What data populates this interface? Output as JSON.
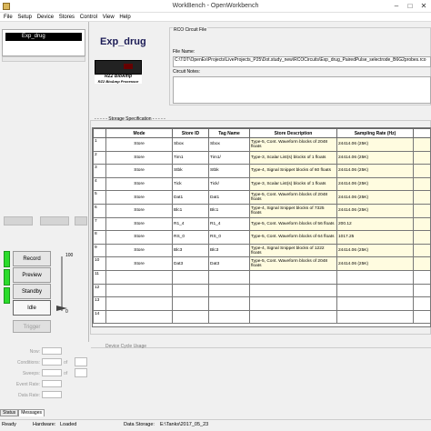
{
  "window": {
    "title": "WorkBench - OpenWorkbench",
    "min": "–",
    "max": "□",
    "close": "✕"
  },
  "menu": [
    "File",
    "Setup",
    "Device",
    "Stores",
    "Control",
    "View",
    "Help"
  ],
  "tree": {
    "selected": "Exp_drug"
  },
  "states": {
    "record": "Record",
    "preview": "Preview",
    "standby": "Standby",
    "idle": "Idle",
    "trigger": "Trigger",
    "slider_top": "100",
    "slider_bottom": "0"
  },
  "block": {
    "name": "Exp_drug",
    "device_label": "RZ2 BioAmp Processor",
    "device_sublabel": "RZ2 BioAmp"
  },
  "rco": {
    "legend": "RCO Circuit File",
    "filename_label": "File Name:",
    "filename": "C:\\TDT\\OpenEx\\Projects\\LiveProjects_P25\\Dot.study_new\\RCOCircuits\\Exp_drug_PairedPulse_selectrode_B6G2probes.rco",
    "notes_label": "Circuit Notes:"
  },
  "storage": {
    "legend": "Storage Specification",
    "columns": [
      "",
      "Mode",
      "Store ID",
      "Tag Name",
      "Store Description",
      "Sampling Rate (Hz)",
      ""
    ],
    "rows": [
      {
        "idx": "1",
        "mode": "Store",
        "store": "Sbox",
        "tag": "Sbox",
        "desc": "Type-5, Cont. Waveform blocks of 2048 floats",
        "rate": "24414.06 (25K)"
      },
      {
        "idx": "2",
        "mode": "Store",
        "store": "Tim1",
        "tag": "Tim1/",
        "desc": "Type-3, Scalar List(s) blocks of 1 floats",
        "rate": "24414.06 (25K)"
      },
      {
        "idx": "3",
        "mode": "Store",
        "store": "Stbk",
        "tag": "Stbk",
        "desc": "Type-4, Signal Snippet blocks of 60 floats",
        "rate": "24414.06 (25K)"
      },
      {
        "idx": "4",
        "mode": "Store",
        "store": "Tick",
        "tag": "Tick/",
        "desc": "Type-3, Scalar List(s) blocks of 1 floats",
        "rate": "24414.06 (25K)"
      },
      {
        "idx": "5",
        "mode": "Store",
        "store": "Dat1",
        "tag": "Dat1",
        "desc": "Type-5, Cont. Waveform blocks of 2048 floats",
        "rate": "24414.06 (25K)"
      },
      {
        "idx": "6",
        "mode": "Store",
        "store": "Blc1",
        "tag": "Blc1",
        "desc": "Type-4, Signal Snippet blocks of 7325 floats",
        "rate": "24414.06 (25K)"
      },
      {
        "idx": "7",
        "mode": "Store",
        "store": "R1_4",
        "tag": "R1_4",
        "desc": "Type-5, Cont. Waveform blocks of 56 floats",
        "rate": "200.12"
      },
      {
        "idx": "8",
        "mode": "Store",
        "store": "RS_0",
        "tag": "RS_0",
        "desc": "Type-5, Cont. Waveform blocks of 64 floats",
        "rate": "1017.25"
      },
      {
        "idx": "9",
        "mode": "Store",
        "store": "Blc3",
        "tag": "Blc3",
        "desc": "Type-4, Signal Snippet blocks of 1222 floats",
        "rate": "24414.06 (25K)"
      },
      {
        "idx": "10",
        "mode": "Store",
        "store": "Dat3",
        "tag": "Dat3",
        "desc": "Type-5, Cont. Waveform blocks of 2048 floats",
        "rate": "24414.06 (25K)"
      },
      {
        "idx": "11",
        "mode": "",
        "store": "",
        "tag": "",
        "desc": "",
        "rate": ""
      },
      {
        "idx": "12",
        "mode": "",
        "store": "",
        "tag": "",
        "desc": "",
        "rate": ""
      },
      {
        "idx": "13",
        "mode": "",
        "store": "",
        "tag": "",
        "desc": "",
        "rate": ""
      },
      {
        "idx": "14",
        "mode": "",
        "store": "",
        "tag": "",
        "desc": "",
        "rate": ""
      }
    ]
  },
  "form": {
    "fields": [
      {
        "label": "Now:",
        "unit": ""
      },
      {
        "label": "Conditions:",
        "unit": "of"
      },
      {
        "label": "Sweeps:",
        "unit": "of"
      },
      {
        "label": "Event Rate:",
        "unit": ""
      },
      {
        "label": "Data Rate:",
        "unit": ""
      }
    ],
    "cycle_label": "Device Cycle Usage"
  },
  "tabs": [
    "Status",
    "Messages"
  ],
  "status": {
    "ready": "Ready",
    "hardware_label": "Hardware:",
    "hardware_value": "Loaded",
    "storage_label": "Data Storage:",
    "storage_value": "E:\\Tanks\\2017_05_23"
  }
}
